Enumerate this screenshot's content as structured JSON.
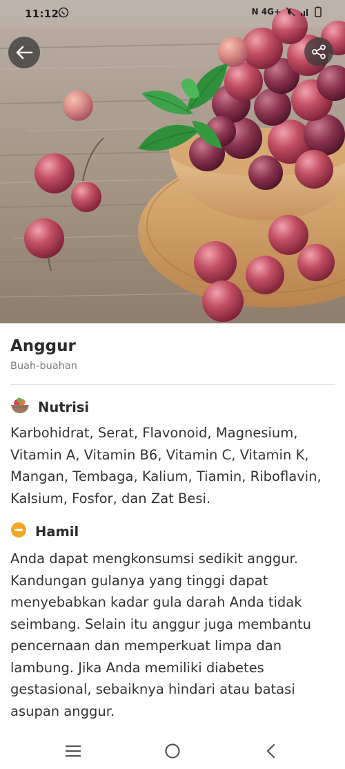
{
  "status_bar": {
    "time": "11:12",
    "right_indicators": "N  4G+"
  },
  "food": {
    "name": "Anggur",
    "category": "Buah-buahan"
  },
  "sections": {
    "nutrition": {
      "title": "Nutrisi",
      "icon": "fruit-basket-icon",
      "text": "Karbohidrat, Serat, Flavonoid, Magnesium, Vitamin A, Vitamin B6, Vitamin C, Vitamin K, Mangan, Tembaga, Kalium, Tiamin, Riboflavin, Kalsium, Fosfor, dan Zat Besi."
    },
    "pregnancy": {
      "title": "Hamil",
      "icon": "caution-minus-icon",
      "status_color": "#f5a623",
      "text": "Anda dapat mengkonsumsi sedikit anggur. Kandungan gulanya yang tinggi dapat menyebabkan kadar gula darah Anda tidak seimbang. Selain itu anggur juga membantu pencernaan dan memperkuat limpa dan lambung. Jika Anda memiliki diabetes gestasional, sebaiknya hindari atau batasi asupan anggur."
    }
  },
  "colors": {
    "accent_warning": "#f5a623",
    "grape": "#b04455",
    "wood": "#d9b07c"
  }
}
